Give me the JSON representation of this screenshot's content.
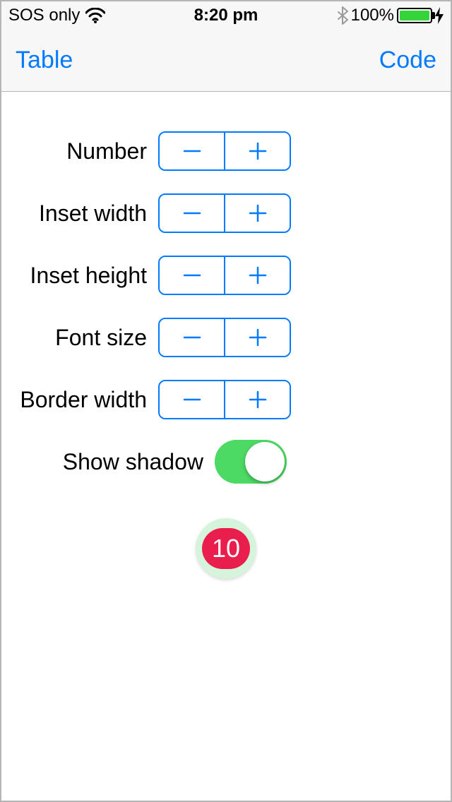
{
  "status": {
    "carrier": "SOS only",
    "time": "8:20 pm",
    "battery_pct": "100%"
  },
  "nav": {
    "left": "Table",
    "right": "Code"
  },
  "controls": {
    "number": {
      "label": "Number"
    },
    "inset_width": {
      "label": "Inset width"
    },
    "inset_height": {
      "label": "Inset height"
    },
    "font_size": {
      "label": "Font size"
    },
    "border_width": {
      "label": "Border width"
    },
    "show_shadow": {
      "label": "Show shadow",
      "on": true
    }
  },
  "badge": {
    "value": "10"
  },
  "colors": {
    "tint": "#007aff",
    "switch_on": "#4cd964",
    "badge_bg": "#e91e4d",
    "badge_ring": "#d6f4db",
    "battery_fill": "#34d43a"
  }
}
